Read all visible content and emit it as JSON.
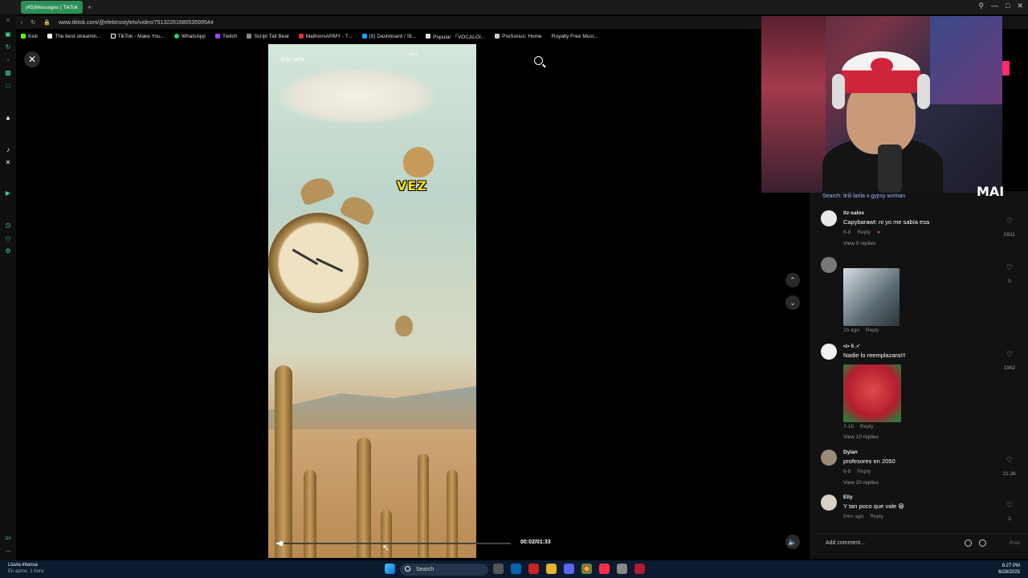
{
  "browser": {
    "tab_label": "(45)Messages | TikTok",
    "tab_new": "+",
    "url": "www.tiktok.com/@elektrostyletv/video/7513226168053599544",
    "bookmarks": [
      "Kick",
      "The best streamin...",
      "TikTok - Make You...",
      "WhatsApp",
      "Twitch",
      "Script Tall Beat",
      "MaifrensARMY - T...",
      "(5) Dashboard / St...",
      "Popular 「VOCALOI...",
      "PreSonus: Home",
      "Royalty Free Musi..."
    ]
  },
  "video": {
    "search_query": "lirilo larila",
    "ad_label": "AGX",
    "caption_word": "VEZ",
    "progress_fraction": 0.02,
    "time": "00:02/01:33"
  },
  "panel": {
    "search_line": "Search: lirili larila x gypsy woman",
    "comments": [
      {
        "user": "itz-salos",
        "text": "Capybarawt: ni yo me sabía esa",
        "date": "6-8",
        "reply": "Reply",
        "likes": "5911",
        "replies": "View 9 replies"
      },
      {
        "user": "",
        "text": "",
        "date": "1h ago",
        "reply": "Reply",
        "likes": "0",
        "replies": ""
      },
      {
        "user": "•z• 5 .•'",
        "text": "Nadie lo reemplazara!!!",
        "date": "7-16",
        "reply": "Reply",
        "likes": "1982",
        "replies": "View 10 replies"
      },
      {
        "user": "Dylan",
        "text": "profesores en 2050",
        "date": "6-8",
        "reply": "Reply",
        "likes": "21.3K",
        "replies": "View 20 replies"
      },
      {
        "user": "Elly",
        "text": "Y tan poco que vale 😆",
        "date": "54m ago",
        "reply": "Reply",
        "likes": "2",
        "replies": ""
      }
    ],
    "add_comment": "Add comment...",
    "post": "Post"
  },
  "webcam": {
    "overlay_text": "MAI"
  },
  "taskbar": {
    "weather_title": "Lluvia intensa",
    "weather_sub": "En aprox. 1 hora",
    "search": "Search",
    "time": "8:27 PM",
    "date": "6/28/2025"
  },
  "colors": {
    "accent_green": "#2c8f55",
    "caption_yellow": "#ffe100",
    "taskbar": "#0b1a2e"
  }
}
